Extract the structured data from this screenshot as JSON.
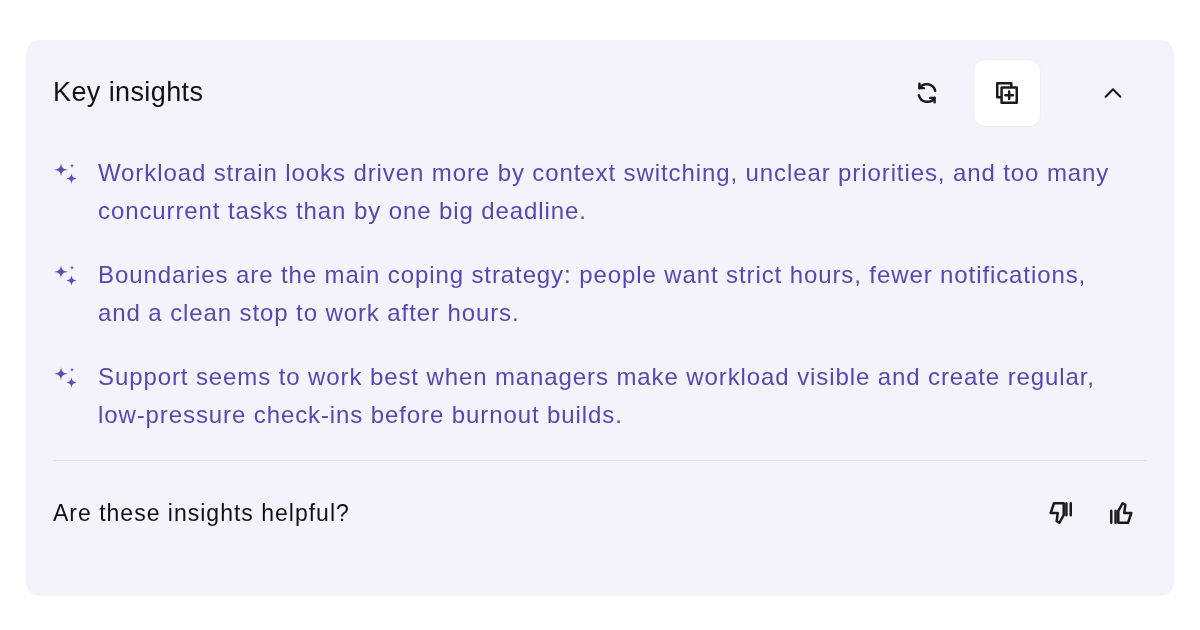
{
  "panel": {
    "title": "Key insights",
    "header_buttons": [
      {
        "kind": "refresh",
        "highlighted": false
      },
      {
        "kind": "copy",
        "highlighted": true
      },
      {
        "kind": "collapse",
        "highlighted": false
      }
    ],
    "insights": [
      "Workload strain looks driven more by context switching, unclear priorities, and too many concurrent tasks than by one big deadline.",
      "Boundaries are the main coping strategy: people want strict hours, fewer notifications, and a clean stop to work after hours.",
      "Support seems to work best when managers make workload visible and create regular, low-pressure check-ins before burnout builds."
    ],
    "feedback": {
      "question": "Are these insights helpful?",
      "buttons": [
        {
          "kind": "thumbs-down"
        },
        {
          "kind": "thumbs-up"
        }
      ]
    }
  }
}
